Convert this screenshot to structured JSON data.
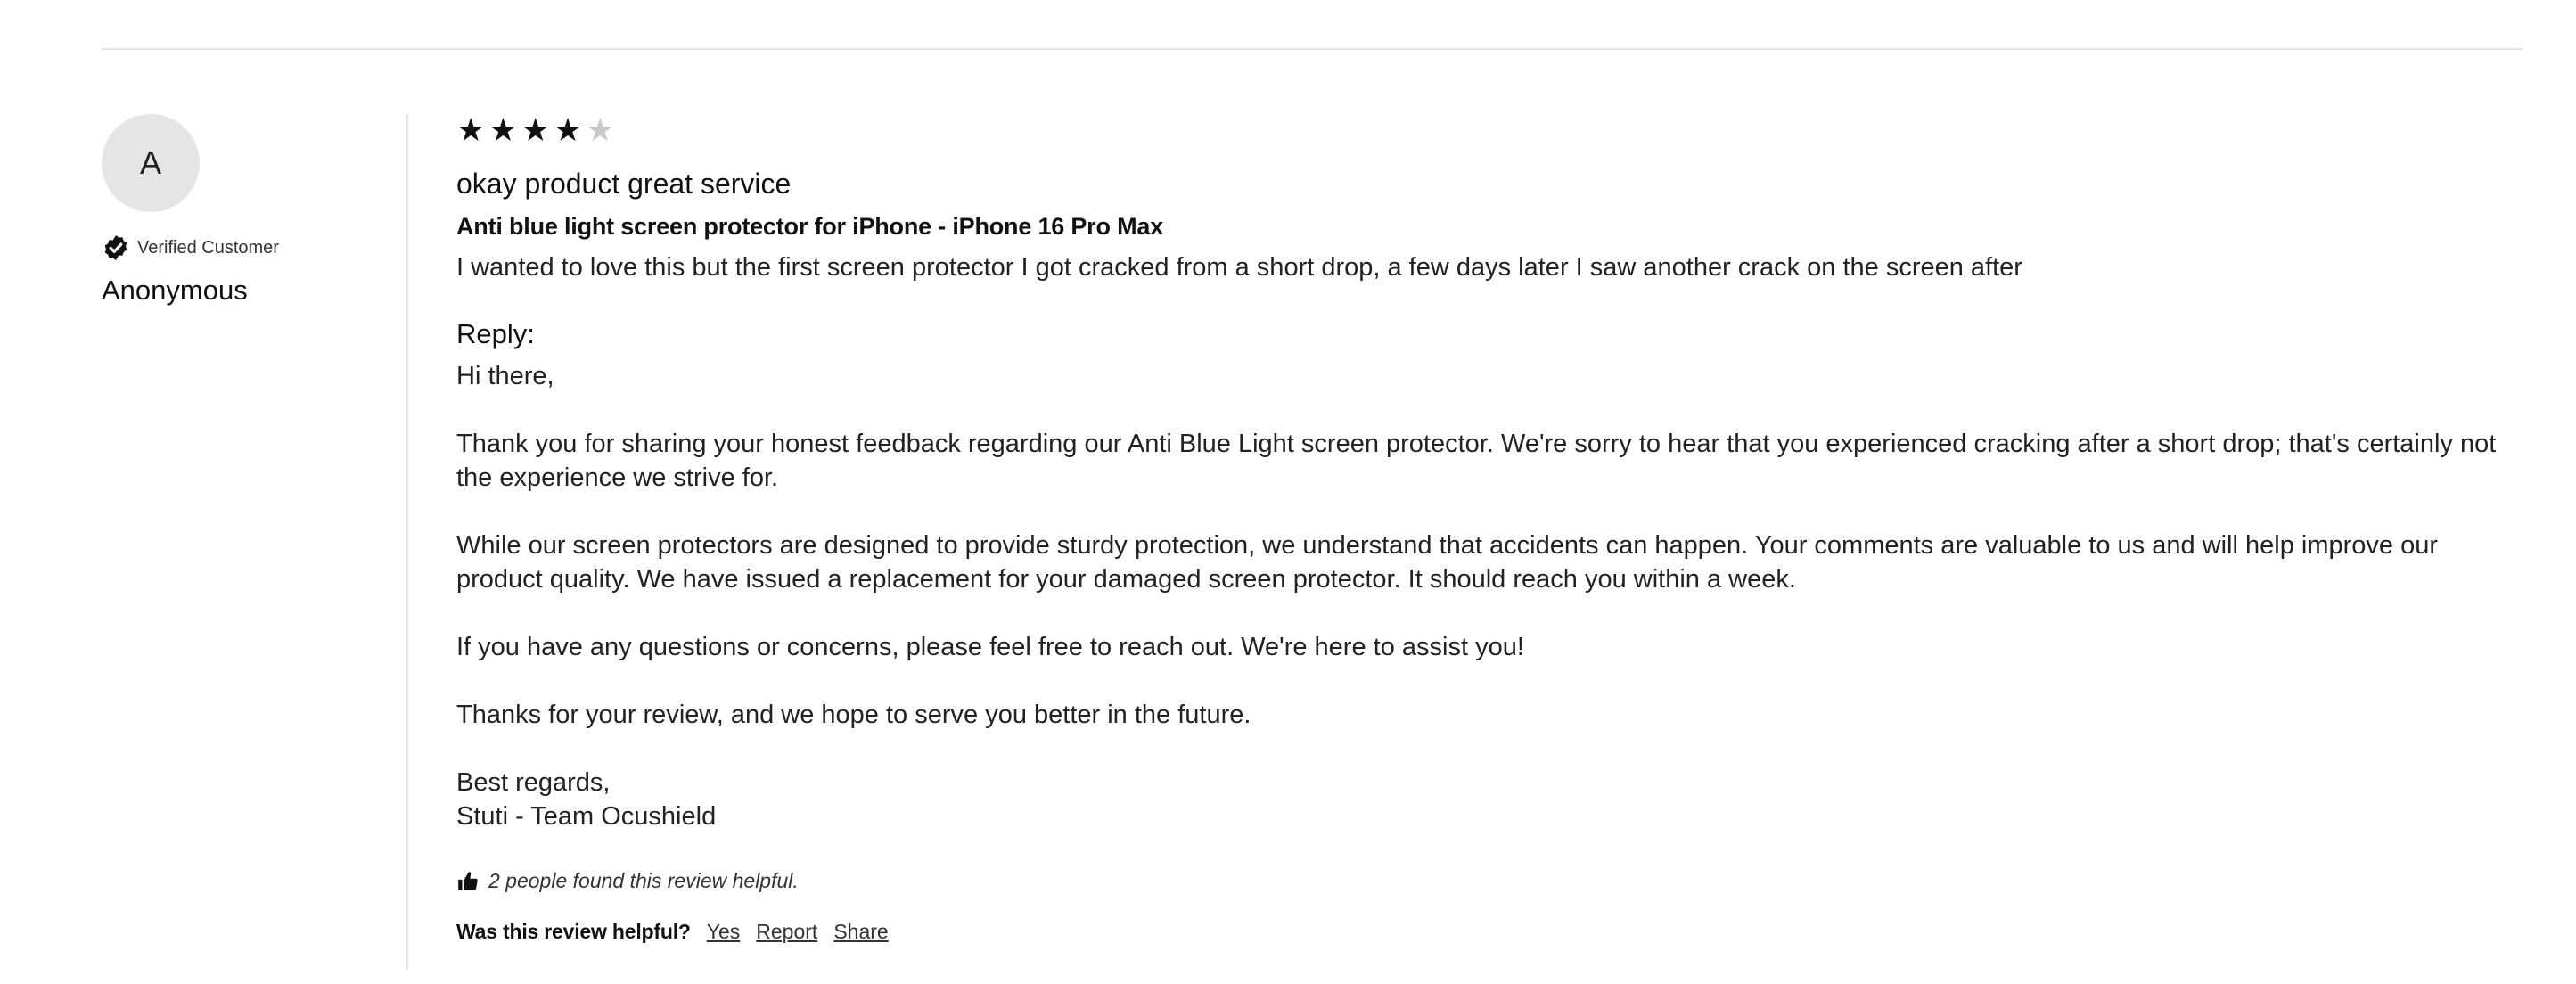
{
  "reviewer": {
    "avatar_initial": "A",
    "verified_label": "Verified Customer",
    "name": "Anonymous"
  },
  "review": {
    "rating": 4,
    "rating_max": 5,
    "title": "okay product great service",
    "product": "Anti blue light screen protector for iPhone - iPhone 16 Pro Max",
    "body": "I wanted to love this but the first screen protector I got cracked from a short drop, a few days later I saw another crack on the screen after"
  },
  "reply": {
    "label": "Reply:",
    "greeting": "Hi there,",
    "p1": "Thank you for sharing your honest feedback regarding our Anti Blue Light screen protector. We're sorry to hear that you experienced cracking after a short drop; that's certainly not the experience we strive for.",
    "p2": "While our screen protectors are designed to provide sturdy protection, we understand that accidents can happen. Your comments are valuable to us and will help improve our product quality. We have issued a replacement for your damaged screen protector. It should reach you within a week.",
    "p3": "If you have any questions or concerns, please feel free to reach out. We're here to assist you!",
    "p4": "Thanks for your review, and we hope to serve you better in the future.",
    "signoff": "Best regards,",
    "signature": "Stuti - Team Ocushield"
  },
  "helpful": {
    "count_text": "2 people found this review helpful.",
    "question": "Was this review helpful?",
    "yes_label": "Yes",
    "report_label": "Report",
    "share_label": "Share"
  },
  "colors": {
    "star_filled": "#111111",
    "star_empty": "#c8c8c8",
    "avatar_bg": "#e5e5e5",
    "divider": "#e4e4e4"
  },
  "icons": {
    "verified": "verified-check-badge-icon",
    "helpful": "thumbs-up-icon",
    "star": "star-icon"
  }
}
